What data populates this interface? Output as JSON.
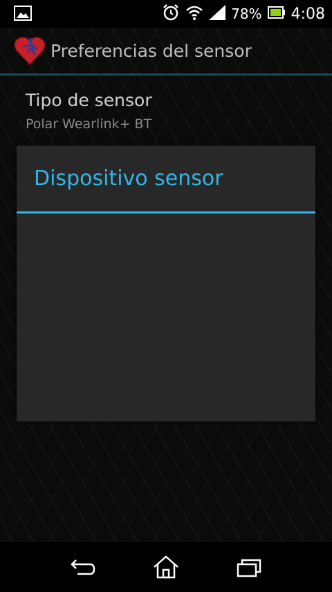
{
  "status_bar": {
    "battery_percent": "78%",
    "time": "4:08",
    "icons": [
      "picture-icon",
      "alarm-icon",
      "wifi-icon",
      "signal-icon",
      "battery-icon"
    ]
  },
  "action_bar": {
    "title": "Preferencias del sensor",
    "app_icon": "heart-runner-icon"
  },
  "preference": {
    "title": "Tipo de sensor",
    "summary": "Polar Wearlink+ BT"
  },
  "dialog": {
    "title": "Dispositivo sensor"
  },
  "nav_bar": {
    "icons": [
      "back-icon",
      "home-icon",
      "recent-apps-icon"
    ]
  },
  "colors": {
    "accent": "#33b5e5",
    "action_divider": "#1b4a5c",
    "dialog_bg": "#282828",
    "heart": "#c8202a"
  }
}
